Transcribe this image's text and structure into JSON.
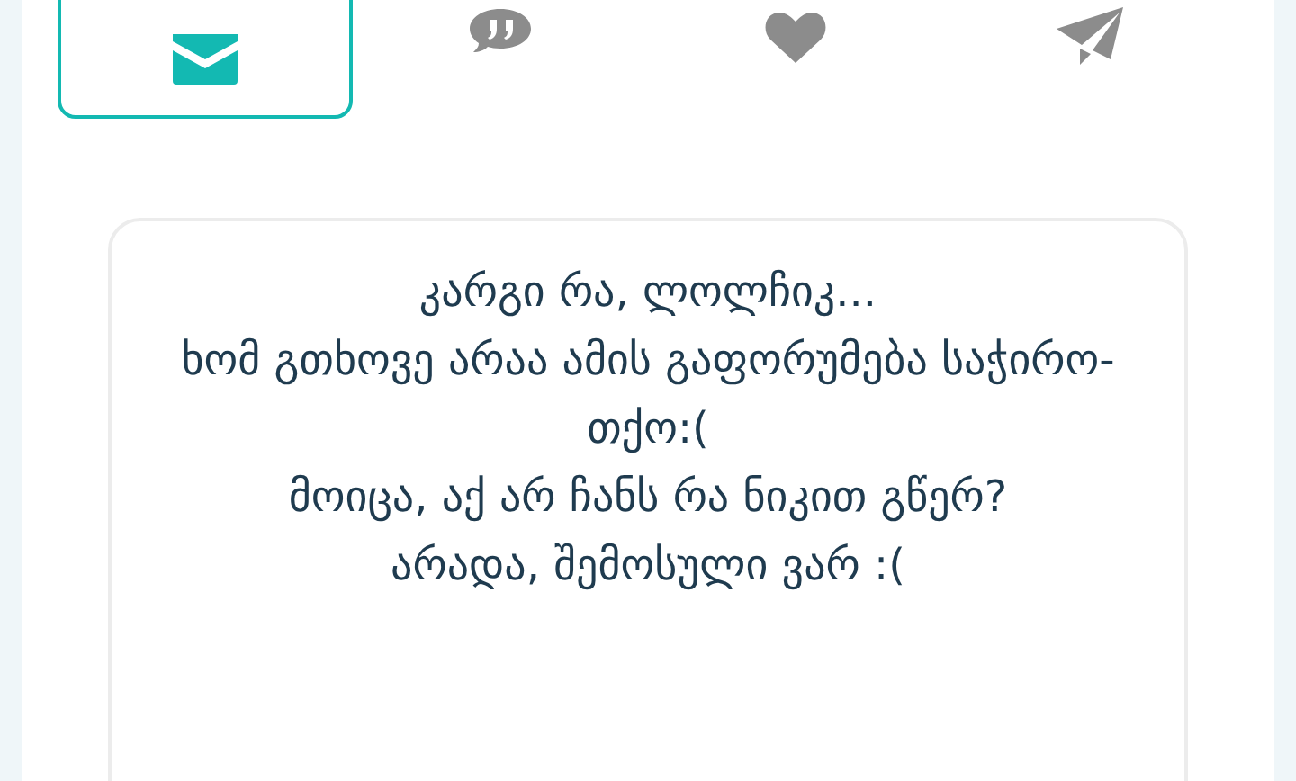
{
  "tabs": [
    {
      "kind": "envelope",
      "selected": true
    },
    {
      "kind": "quote",
      "selected": false
    },
    {
      "kind": "heart",
      "selected": false
    },
    {
      "kind": "paper-plane",
      "selected": false
    }
  ],
  "message": {
    "lines": [
      "კარგი რა, ლოლჩიკ...",
      "ხომ გთხოვე არაა ამის გაფორუმება საჭირო-თქო:(",
      "მოიცა, აქ არ ჩანს რა ნიკით გწერ?",
      "არადა, შემოსული ვარ :("
    ]
  }
}
